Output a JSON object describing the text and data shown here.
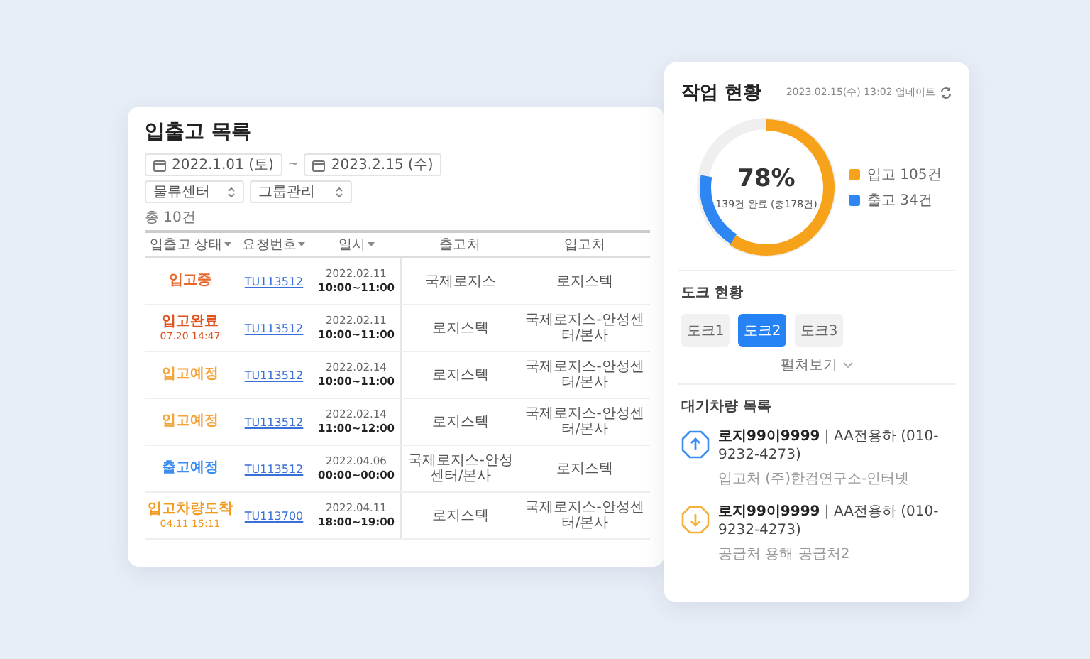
{
  "orders": {
    "title": "입출고 목록",
    "date_from": "2022.1.01 (토)",
    "date_separator": "~",
    "date_to": "2023.2.15 (수)",
    "selects": [
      "물류센터",
      "그룹관리"
    ],
    "count": "총 10건",
    "columns": [
      {
        "label": "입출고 상태",
        "sortable": true
      },
      {
        "label": "요청번호",
        "sortable": true
      },
      {
        "label": "일시",
        "sortable": true
      },
      {
        "label": "출고처",
        "sortable": false
      },
      {
        "label": "입고처",
        "sortable": false
      }
    ],
    "rows": [
      {
        "status": "입고중",
        "status_time": "",
        "color": "#e8662a",
        "request": "TU113512",
        "date": "2022.02.11",
        "time": "10:00~11:00",
        "origin": "국제로지스",
        "destination": "로지스텍"
      },
      {
        "status": "입고완료",
        "status_time": "07.20 14:47",
        "color": "#e0521f",
        "request": "TU113512",
        "date": "2022.02.11",
        "time": "10:00~11:00",
        "origin": "로지스텍",
        "destination": "국제로지스-안성센터/본사"
      },
      {
        "status": "입고예정",
        "status_time": "",
        "color": "#f5a43a",
        "request": "TU113512",
        "date": "2022.02.14",
        "time": "10:00~11:00",
        "origin": "로지스텍",
        "destination": "국제로지스-안성센터/본사"
      },
      {
        "status": "입고예정",
        "status_time": "",
        "color": "#f5a43a",
        "request": "TU113512",
        "date": "2022.02.14",
        "time": "11:00~12:00",
        "origin": "로지스텍",
        "destination": "국제로지스-안성센터/본사"
      },
      {
        "status": "출고예정",
        "status_time": "",
        "color": "#3b8ef0",
        "request": "TU113512",
        "date": "2022.04.06",
        "time": "00:00~00:00",
        "origin": "국제로지스-안성센터/본사",
        "destination": "로지스텍"
      },
      {
        "status": "입고차량도착",
        "status_time": "04.11 15:11",
        "color": "#f39a1e",
        "request": "TU113700",
        "date": "2022.04.11",
        "time": "18:00~19:00",
        "origin": "로지스텍",
        "destination": "국제로지스-안성센터/본사"
      }
    ]
  },
  "status": {
    "title": "작업 현황",
    "updated": "2023.02.15(수) 13:02 업데이트",
    "percent": "78%",
    "summary": "139건 완료 (총178건)",
    "segments": [
      {
        "label": "입고 105건",
        "color": "#f7a21b",
        "level": 0.59
      },
      {
        "label": "출고 34건",
        "color": "#2d86f1",
        "level": 0.19
      }
    ],
    "dock_title": "도크 현황",
    "docks": [
      {
        "label": "도크1",
        "selected": false
      },
      {
        "label": "도크2",
        "selected": true
      },
      {
        "label": "도크3",
        "selected": false
      }
    ],
    "expand": "펼쳐보기",
    "queue_title": "대기차량 목록",
    "vehicles": [
      {
        "kind": "inbound",
        "plate": "로지99이9999",
        "info": " | AA전용하 (010-9232-4273)",
        "place": "입고처 (주)한컴연구소-인터넷"
      },
      {
        "kind": "outbound",
        "plate": "로지99이9999",
        "info": " | AA전용하 (010-9232-4273)",
        "place": "공급처 용해 공급처2"
      }
    ]
  }
}
